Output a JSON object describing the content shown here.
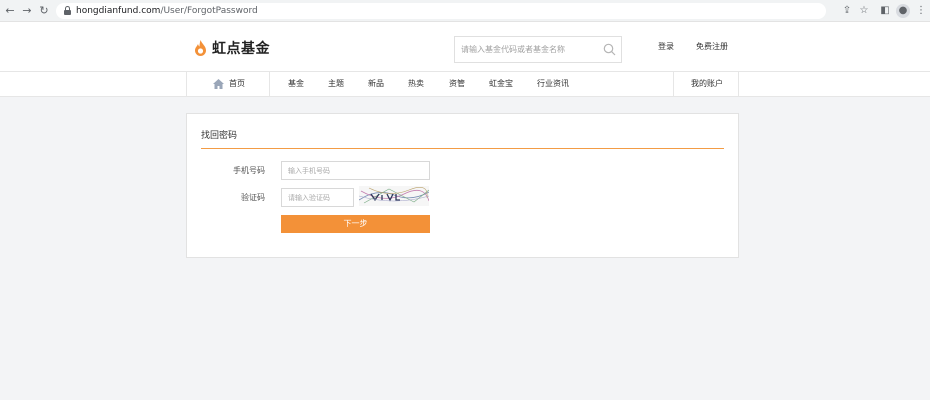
{
  "browser": {
    "url_host": "hongdianfund.com",
    "url_path": "/User/ForgotPassword"
  },
  "header": {
    "logo_text": "虹点基金",
    "search_placeholder": "请输入基金代码或者基金名称",
    "login_label": "登录",
    "register_label": "免费注册"
  },
  "nav": {
    "home": "首页",
    "items": [
      "基金",
      "主题",
      "新品",
      "热卖",
      "资管",
      "虹金宝",
      "行业资讯"
    ],
    "account": "我的账户"
  },
  "form": {
    "title": "找回密码",
    "phone_label": "手机号码",
    "phone_placeholder": "输入手机号码",
    "captcha_label": "验证码",
    "captcha_placeholder": "请输入验证码",
    "next_label": "下一步"
  },
  "colors": {
    "accent": "#f39138",
    "background": "#f3f4f6"
  }
}
